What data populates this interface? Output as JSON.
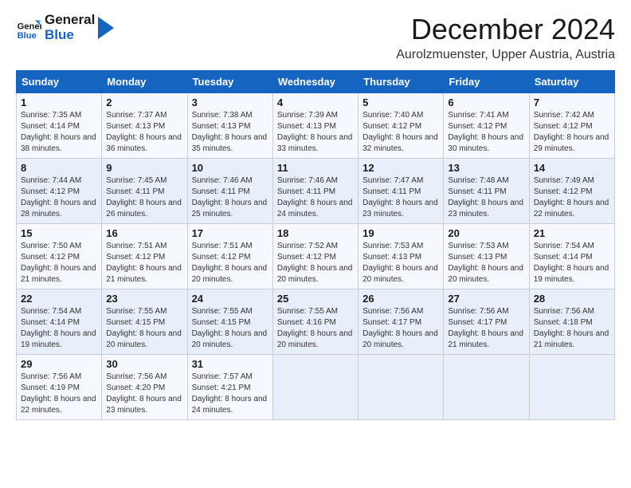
{
  "logo": {
    "line1": "General",
    "line2": "Blue"
  },
  "header": {
    "month": "December 2024",
    "location": "Aurolzmuenster, Upper Austria, Austria"
  },
  "weekdays": [
    "Sunday",
    "Monday",
    "Tuesday",
    "Wednesday",
    "Thursday",
    "Friday",
    "Saturday"
  ],
  "weeks": [
    [
      {
        "day": "1",
        "sunrise": "7:35 AM",
        "sunset": "4:14 PM",
        "daylight": "8 hours and 38 minutes."
      },
      {
        "day": "2",
        "sunrise": "7:37 AM",
        "sunset": "4:13 PM",
        "daylight": "8 hours and 36 minutes."
      },
      {
        "day": "3",
        "sunrise": "7:38 AM",
        "sunset": "4:13 PM",
        "daylight": "8 hours and 35 minutes."
      },
      {
        "day": "4",
        "sunrise": "7:39 AM",
        "sunset": "4:13 PM",
        "daylight": "8 hours and 33 minutes."
      },
      {
        "day": "5",
        "sunrise": "7:40 AM",
        "sunset": "4:12 PM",
        "daylight": "8 hours and 32 minutes."
      },
      {
        "day": "6",
        "sunrise": "7:41 AM",
        "sunset": "4:12 PM",
        "daylight": "8 hours and 30 minutes."
      },
      {
        "day": "7",
        "sunrise": "7:42 AM",
        "sunset": "4:12 PM",
        "daylight": "8 hours and 29 minutes."
      }
    ],
    [
      {
        "day": "8",
        "sunrise": "7:44 AM",
        "sunset": "4:12 PM",
        "daylight": "8 hours and 28 minutes."
      },
      {
        "day": "9",
        "sunrise": "7:45 AM",
        "sunset": "4:11 PM",
        "daylight": "8 hours and 26 minutes."
      },
      {
        "day": "10",
        "sunrise": "7:46 AM",
        "sunset": "4:11 PM",
        "daylight": "8 hours and 25 minutes."
      },
      {
        "day": "11",
        "sunrise": "7:46 AM",
        "sunset": "4:11 PM",
        "daylight": "8 hours and 24 minutes."
      },
      {
        "day": "12",
        "sunrise": "7:47 AM",
        "sunset": "4:11 PM",
        "daylight": "8 hours and 23 minutes."
      },
      {
        "day": "13",
        "sunrise": "7:48 AM",
        "sunset": "4:11 PM",
        "daylight": "8 hours and 23 minutes."
      },
      {
        "day": "14",
        "sunrise": "7:49 AM",
        "sunset": "4:12 PM",
        "daylight": "8 hours and 22 minutes."
      }
    ],
    [
      {
        "day": "15",
        "sunrise": "7:50 AM",
        "sunset": "4:12 PM",
        "daylight": "8 hours and 21 minutes."
      },
      {
        "day": "16",
        "sunrise": "7:51 AM",
        "sunset": "4:12 PM",
        "daylight": "8 hours and 21 minutes."
      },
      {
        "day": "17",
        "sunrise": "7:51 AM",
        "sunset": "4:12 PM",
        "daylight": "8 hours and 20 minutes."
      },
      {
        "day": "18",
        "sunrise": "7:52 AM",
        "sunset": "4:12 PM",
        "daylight": "8 hours and 20 minutes."
      },
      {
        "day": "19",
        "sunrise": "7:53 AM",
        "sunset": "4:13 PM",
        "daylight": "8 hours and 20 minutes."
      },
      {
        "day": "20",
        "sunrise": "7:53 AM",
        "sunset": "4:13 PM",
        "daylight": "8 hours and 20 minutes."
      },
      {
        "day": "21",
        "sunrise": "7:54 AM",
        "sunset": "4:14 PM",
        "daylight": "8 hours and 19 minutes."
      }
    ],
    [
      {
        "day": "22",
        "sunrise": "7:54 AM",
        "sunset": "4:14 PM",
        "daylight": "8 hours and 19 minutes."
      },
      {
        "day": "23",
        "sunrise": "7:55 AM",
        "sunset": "4:15 PM",
        "daylight": "8 hours and 20 minutes."
      },
      {
        "day": "24",
        "sunrise": "7:55 AM",
        "sunset": "4:15 PM",
        "daylight": "8 hours and 20 minutes."
      },
      {
        "day": "25",
        "sunrise": "7:55 AM",
        "sunset": "4:16 PM",
        "daylight": "8 hours and 20 minutes."
      },
      {
        "day": "26",
        "sunrise": "7:56 AM",
        "sunset": "4:17 PM",
        "daylight": "8 hours and 20 minutes."
      },
      {
        "day": "27",
        "sunrise": "7:56 AM",
        "sunset": "4:17 PM",
        "daylight": "8 hours and 21 minutes."
      },
      {
        "day": "28",
        "sunrise": "7:56 AM",
        "sunset": "4:18 PM",
        "daylight": "8 hours and 21 minutes."
      }
    ],
    [
      {
        "day": "29",
        "sunrise": "7:56 AM",
        "sunset": "4:19 PM",
        "daylight": "8 hours and 22 minutes."
      },
      {
        "day": "30",
        "sunrise": "7:56 AM",
        "sunset": "4:20 PM",
        "daylight": "8 hours and 23 minutes."
      },
      {
        "day": "31",
        "sunrise": "7:57 AM",
        "sunset": "4:21 PM",
        "daylight": "8 hours and 24 minutes."
      },
      null,
      null,
      null,
      null
    ]
  ]
}
